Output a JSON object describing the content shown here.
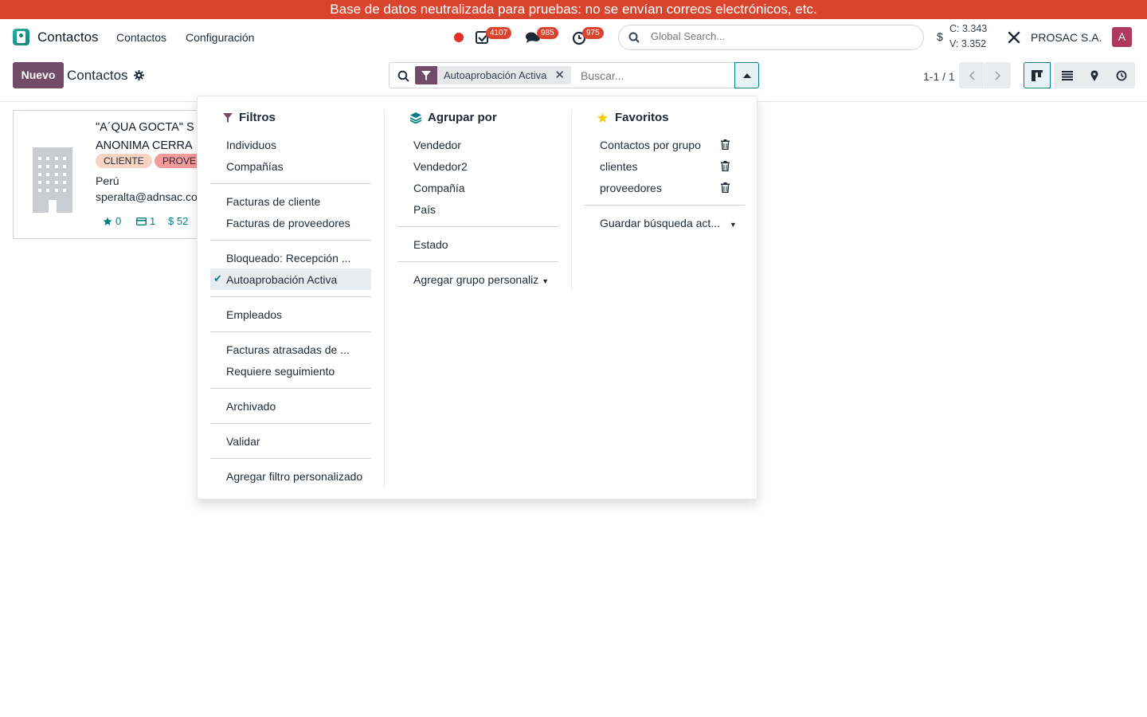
{
  "banner": {
    "text": "Base de datos neutralizada para pruebas: no se envían correos electrónicos, etc."
  },
  "navbar": {
    "app_name": "Contactos",
    "menu": [
      "Contactos",
      "Configuración"
    ],
    "badges": {
      "activities": "4107",
      "messages": "985",
      "timesheets": "975"
    },
    "search_placeholder": "Global Search...",
    "rate_buy": "C: 3.343",
    "rate_sell": "V: 3.352",
    "currency_symbol": "$",
    "company": "PROSAC S.A.",
    "avatar_letter": "A"
  },
  "control": {
    "new_button": "Nuevo",
    "title": "Contactos",
    "facet_label": "Autoaprobación Activa",
    "search_placeholder": "Buscar...",
    "pager": "1-1 / 1"
  },
  "card": {
    "name_line1": "\"A´QUA GOCTA\" S",
    "name_line2": "ANONIMA CERRA",
    "tags": [
      "CLIENTE",
      "PROVE"
    ],
    "country": "Perú",
    "email": "speralta@adnsac.co",
    "stats": {
      "rating": "0",
      "cards": "1",
      "money": "$ 52"
    }
  },
  "dropdown": {
    "filters": {
      "title": "Filtros",
      "groups": [
        [
          "Individuos",
          "Compañías"
        ],
        [
          "Facturas de cliente",
          "Facturas de proveedores"
        ],
        [
          "Bloqueado: Recepción ...",
          "Autoaprobación Activa"
        ],
        [
          "Empleados"
        ],
        [
          "Facturas atrasadas de ...",
          "Requiere seguimiento"
        ],
        [
          "Archivado"
        ],
        [
          "Validar"
        ],
        [
          "Agregar filtro personalizado"
        ]
      ],
      "selected": "Autoaprobación Activa"
    },
    "groupby": {
      "title": "Agrupar por",
      "items": [
        "Vendedor",
        "Vendedor2",
        "Compañía",
        "País"
      ],
      "extra": "Estado",
      "custom": "Agregar grupo personaliz"
    },
    "favorites": {
      "title": "Favoritos",
      "items": [
        "Contactos por grupo",
        "clientes",
        "proveedores"
      ],
      "save": "Guardar búsqueda act..."
    }
  },
  "colors": {
    "primary": "#714b67",
    "teal": "#017e84",
    "banner": "#d9442f",
    "badge": "#d9442f"
  }
}
